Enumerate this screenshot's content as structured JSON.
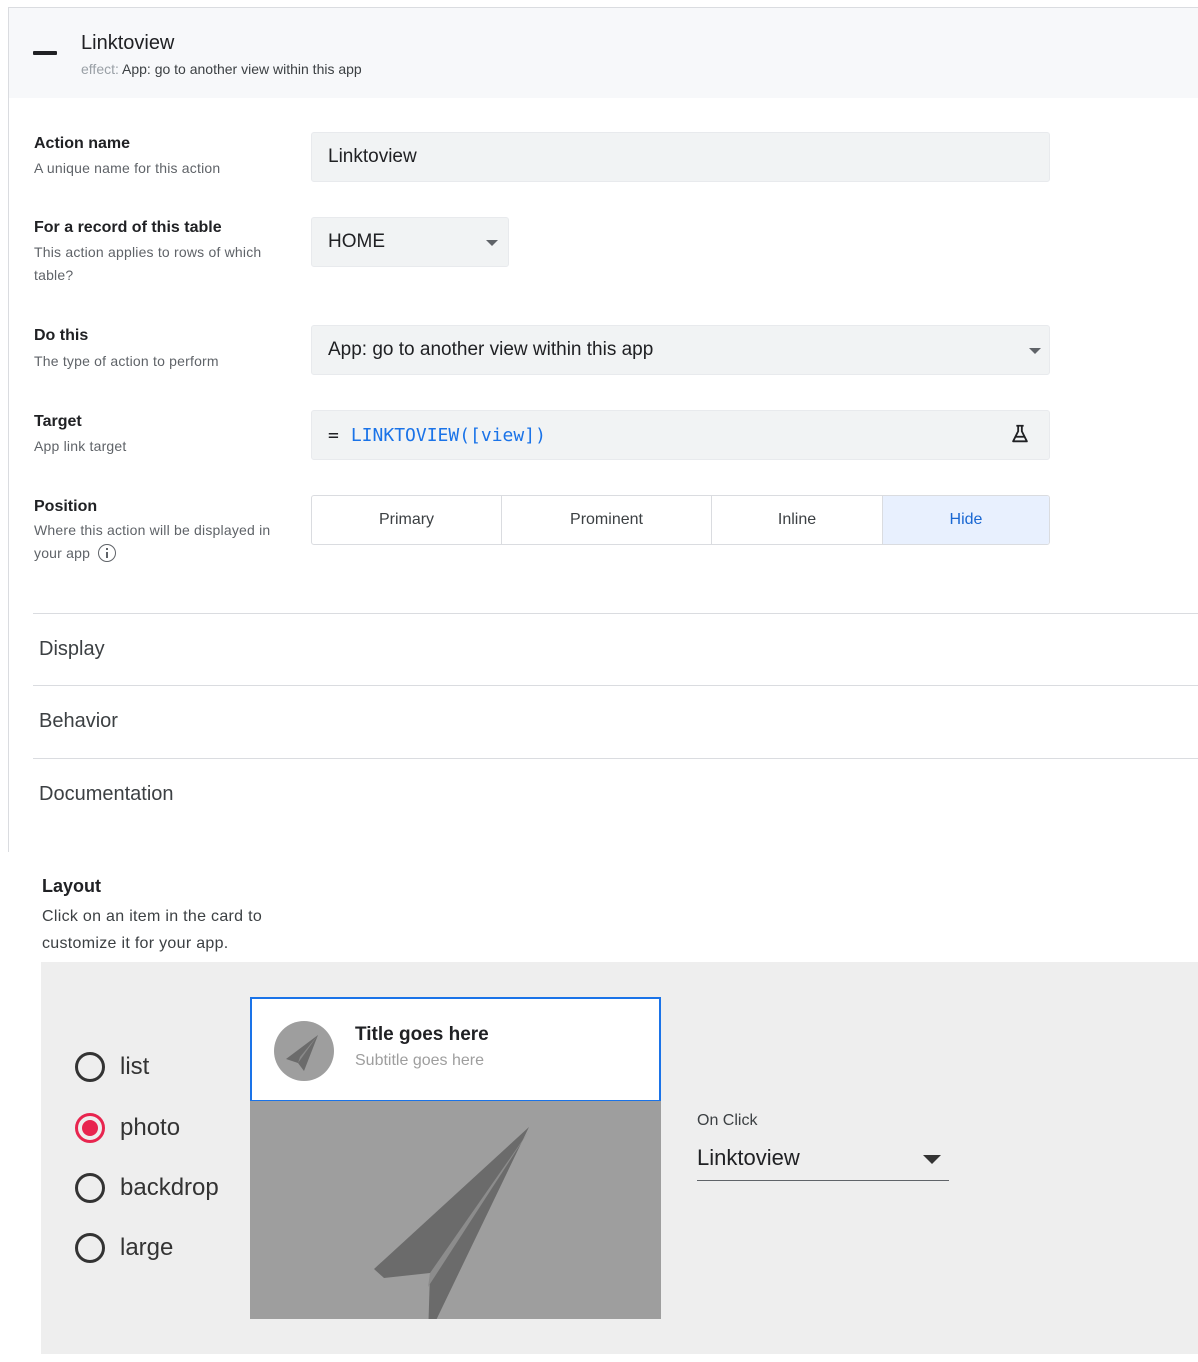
{
  "action": {
    "title": "Linktoview",
    "effect_label": "effect:",
    "effect_value": "App: go to another view within this app"
  },
  "fields": {
    "action_name": {
      "label": "Action name",
      "help": "A unique name for this action",
      "value": "Linktoview"
    },
    "table": {
      "label": "For a record of this table",
      "help": "This action applies to rows of which table?",
      "value": "HOME"
    },
    "do_this": {
      "label": "Do this",
      "help": "The type of action to perform",
      "value": "App: go to another view within this app"
    },
    "target": {
      "label": "Target",
      "help": "App link target",
      "eq": "=",
      "formula": "LINKTOVIEW([view])"
    },
    "position": {
      "label": "Position",
      "help": "Where this action will be displayed in your app",
      "options": [
        "Primary",
        "Prominent",
        "Inline",
        "Hide"
      ],
      "selected": "Hide"
    }
  },
  "sections": [
    "Display",
    "Behavior",
    "Documentation"
  ],
  "layout": {
    "label": "Layout",
    "help": "Click on an item in the card to customize it for your app.",
    "options": [
      "list",
      "photo",
      "backdrop",
      "large"
    ],
    "selected": "photo",
    "card": {
      "title": "Title goes here",
      "subtitle": "Subtitle goes here",
      "icon": "paper-plane-icon"
    },
    "on_click": {
      "label": "On Click",
      "value": "Linktoview"
    }
  },
  "colors": {
    "accent_blue": "#1a73e8",
    "radio_selected": "#e8254f",
    "field_bg": "#f1f3f4",
    "card_gray": "#9e9e9e"
  }
}
